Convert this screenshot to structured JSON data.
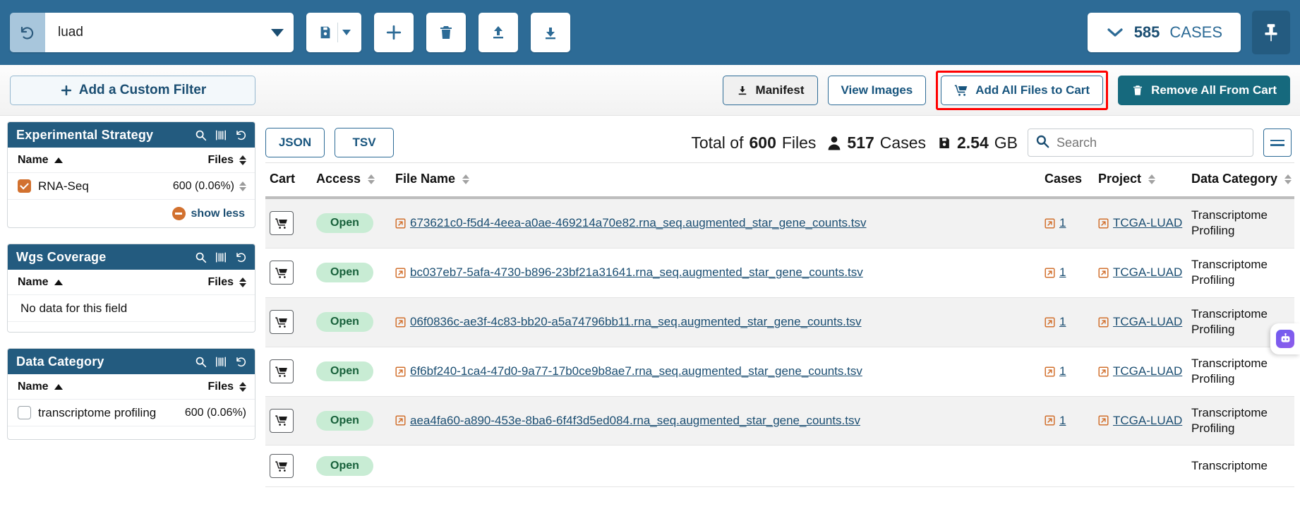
{
  "colors": {
    "header_blue": "#2d6b96",
    "facet_header": "#235b7f",
    "accent_orange": "#d2712f",
    "link_blue": "#1b4e72",
    "highlight_red": "#ff0000",
    "open_badge_bg": "#c8ecd4",
    "open_badge_text": "#17603a",
    "solid_teal": "#16697d"
  },
  "topbar": {
    "reset_icon": "undo-icon",
    "filter_value": "luad",
    "dropdown_icon": "caret-down-icon",
    "buttons": [
      {
        "name": "save-filter-button",
        "icon": "save-icon"
      },
      {
        "name": "add-filter-button",
        "icon": "plus-icon"
      },
      {
        "name": "delete-filter-button",
        "icon": "trash-icon"
      },
      {
        "name": "upload-filter-button",
        "icon": "upload-icon"
      },
      {
        "name": "download-filter-button",
        "icon": "download-icon"
      }
    ],
    "cases_count": "585",
    "cases_label": "CASES",
    "cases_chevron": "chevron-down-icon",
    "pin_icon": "pin-icon"
  },
  "actionrow": {
    "custom_filter_label": "Add a Custom Filter",
    "custom_filter_icon": "plus-icon",
    "manifest_label": "Manifest",
    "manifest_icon": "download-icon",
    "view_images_label": "View Images",
    "add_all_label": "Add All Files to Cart",
    "add_all_icon": "cart-icon",
    "remove_all_label": "Remove All From Cart",
    "remove_all_icon": "trash-icon",
    "highlighted_button": "Add All Files to Cart"
  },
  "sidebar": {
    "facets": [
      {
        "title": "Experimental Strategy",
        "icons": [
          "search-icon",
          "flask-icon",
          "reset-icon"
        ],
        "col_name": "Name",
        "col_files": "Files",
        "rows": [
          {
            "label": "RNA-Seq",
            "count": "600 (0.06%)",
            "checked": true
          }
        ],
        "footer": {
          "label": "show less",
          "icon": "minus-circle-icon"
        }
      },
      {
        "title": "Wgs Coverage",
        "icons": [
          "search-icon",
          "flask-icon",
          "reset-icon"
        ],
        "col_name": "Name",
        "col_files": "Files",
        "empty_text": "No data for this field",
        "rows": []
      },
      {
        "title": "Data Category",
        "icons": [
          "search-icon",
          "flask-icon",
          "reset-icon"
        ],
        "col_name": "Name",
        "col_files": "Files",
        "rows": [
          {
            "label": "transcriptome profiling",
            "count": "600 (0.06%)",
            "checked": false
          }
        ]
      }
    ]
  },
  "table": {
    "format_buttons": [
      "JSON",
      "TSV"
    ],
    "stats": {
      "total_prefix": "Total of",
      "files_count": "600",
      "files_label": "Files",
      "cases_icon": "user-icon",
      "cases_count": "517",
      "cases_label": "Cases",
      "size_icon": "save-icon",
      "size_value": "2.54",
      "size_unit": "GB"
    },
    "search_placeholder": "Search",
    "search_value": "",
    "search_icon": "search-icon",
    "menu_icon": "hamburger-icon",
    "columns": [
      {
        "label": "Cart",
        "sortable": false
      },
      {
        "label": "Access",
        "sortable": true
      },
      {
        "label": "File Name",
        "sortable": true
      },
      {
        "label": "Cases",
        "sortable": false
      },
      {
        "label": "Project",
        "sortable": true
      },
      {
        "label": "Data Category",
        "sortable": true
      }
    ],
    "rows": [
      {
        "cart_icon": "cart-icon",
        "access": "Open",
        "file_name": "673621c0-f5d4-4eea-a0ae-469214a70e82.rna_seq.augmented_star_gene_counts.tsv",
        "cases": "1",
        "project": "TCGA-LUAD",
        "data_category": "Transcriptome Profiling"
      },
      {
        "cart_icon": "cart-icon",
        "access": "Open",
        "file_name": "bc037eb7-5afa-4730-b896-23bf21a31641.rna_seq.augmented_star_gene_counts.tsv",
        "cases": "1",
        "project": "TCGA-LUAD",
        "data_category": "Transcriptome Profiling"
      },
      {
        "cart_icon": "cart-icon",
        "access": "Open",
        "file_name": "06f0836c-ae3f-4c83-bb20-a5a74796bb11.rna_seq.augmented_star_gene_counts.tsv",
        "cases": "1",
        "project": "TCGA-LUAD",
        "data_category": "Transcriptome Profiling"
      },
      {
        "cart_icon": "cart-icon",
        "access": "Open",
        "file_name": "6f6bf240-1ca4-47d0-9a77-17b0ce9b8ae7.rna_seq.augmented_star_gene_counts.tsv",
        "cases": "1",
        "project": "TCGA-LUAD",
        "data_category": "Transcriptome Profiling"
      },
      {
        "cart_icon": "cart-icon",
        "access": "Open",
        "file_name": "aea4fa60-a890-453e-8ba6-6f4f3d5ed084.rna_seq.augmented_star_gene_counts.tsv",
        "cases": "1",
        "project": "TCGA-LUAD",
        "data_category": "Transcriptome Profiling"
      },
      {
        "cart_icon": "cart-icon",
        "access": "Open",
        "file_name": "",
        "cases": "",
        "project": "",
        "data_category": "Transcriptome"
      }
    ]
  },
  "assistant": {
    "icon": "robot-icon"
  }
}
